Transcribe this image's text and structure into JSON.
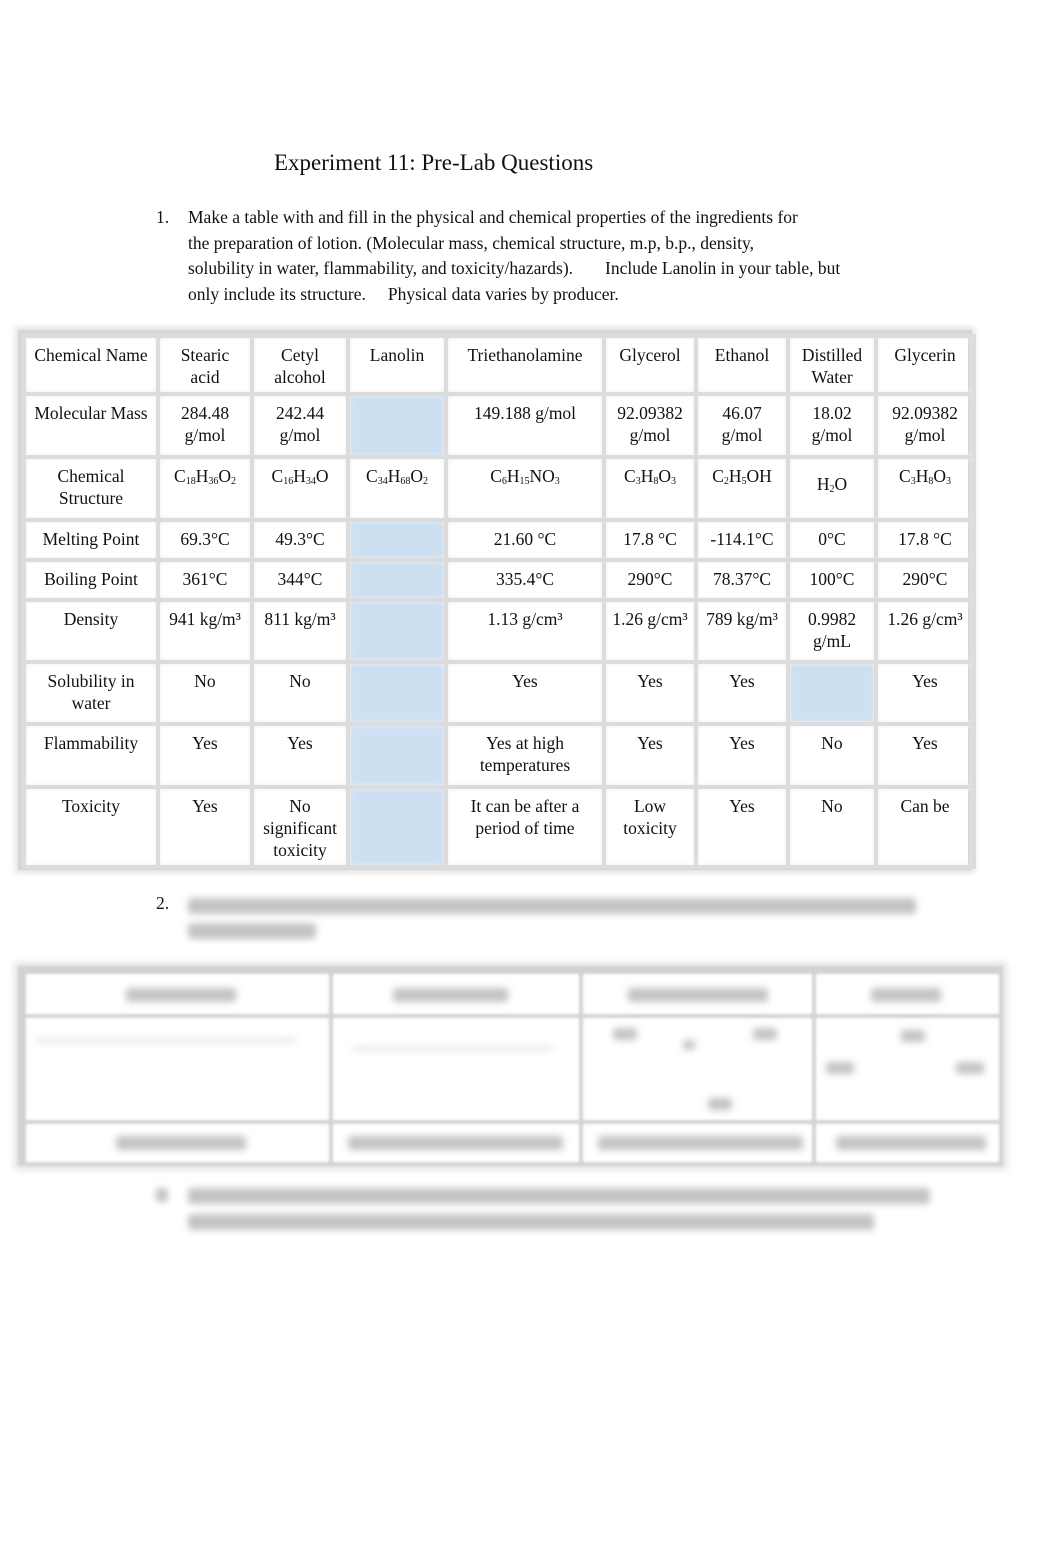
{
  "document": {
    "title": "Experiment 11: Pre-Lab Questions",
    "question1": {
      "number": "1.",
      "line1": "Make a table with and fill in the physical and chemical properties of the ingredients for",
      "line2": "the preparation of lotion. (Molecular mass, chemical structure, m.p, b.p., density,",
      "line3a": "solubility in water, flammability, and toxicity/hazards).",
      "line3b": "Include Lanolin in your table, but",
      "line4a": "only include its structure.",
      "line4b": "Physical data varies by producer."
    },
    "question2": {
      "number": "2.",
      "text_visible": false
    },
    "question3": {
      "text_visible": false
    }
  },
  "properties_table": {
    "highlight_color": "#cde0f2",
    "header": [
      "Chemical Name",
      "Stearic acid",
      "Cetyl alcohol",
      "Lanolin",
      "Triethanolamine",
      "Glycerol",
      "Ethanol",
      "Distilled Water",
      "Glycerin"
    ],
    "rows": [
      {
        "label": "Molecular Mass",
        "values": [
          "284.48 g/mol",
          "242.44 g/mol",
          "",
          "149.188 g/mol",
          "92.09382 g/mol",
          "46.07 g/mol",
          "18.02 g/mol",
          "92.09382 g/mol"
        ]
      },
      {
        "label": "Chemical Structure",
        "values": [
          "C18H36O2",
          "C16H34O",
          "C34H68O2",
          "C6H15NO3",
          "C3H8O3",
          "C2H5OH",
          "H2O",
          "C3H8O3"
        ]
      },
      {
        "label": "Melting Point",
        "values": [
          "69.3°C",
          "49.3°C",
          "",
          "21.60 °C",
          "17.8 °C",
          "-114.1°C",
          "0°C",
          "17.8 °C"
        ]
      },
      {
        "label": "Boiling Point",
        "values": [
          "361°C",
          "344°C",
          "",
          "335.4°C",
          "290°C",
          "78.37°C",
          "100°C",
          "290°C"
        ]
      },
      {
        "label": "Density",
        "values": [
          "941 kg/m³",
          "811 kg/m³",
          "",
          "1.13 g/cm³",
          "1.26 g/cm³",
          "789 kg/m³",
          "0.9982 g/mL",
          "1.26 g/cm³"
        ]
      },
      {
        "label": "Solubility in water",
        "values": [
          "No",
          "No",
          "",
          "Yes",
          "Yes",
          "Yes",
          "",
          "Yes"
        ]
      },
      {
        "label": "Flammability",
        "values": [
          "Yes",
          "Yes",
          "",
          "Yes at high temperatures",
          "Yes",
          "Yes",
          "No",
          "Yes"
        ]
      },
      {
        "label": "Toxicity",
        "values": [
          "Yes",
          "No significant toxicity",
          "",
          "It can be after a period of time",
          "Low toxicity",
          "Yes",
          "No",
          "Can be"
        ]
      }
    ]
  },
  "functional_group_table": {
    "columns": 4,
    "content_visible": false
  }
}
